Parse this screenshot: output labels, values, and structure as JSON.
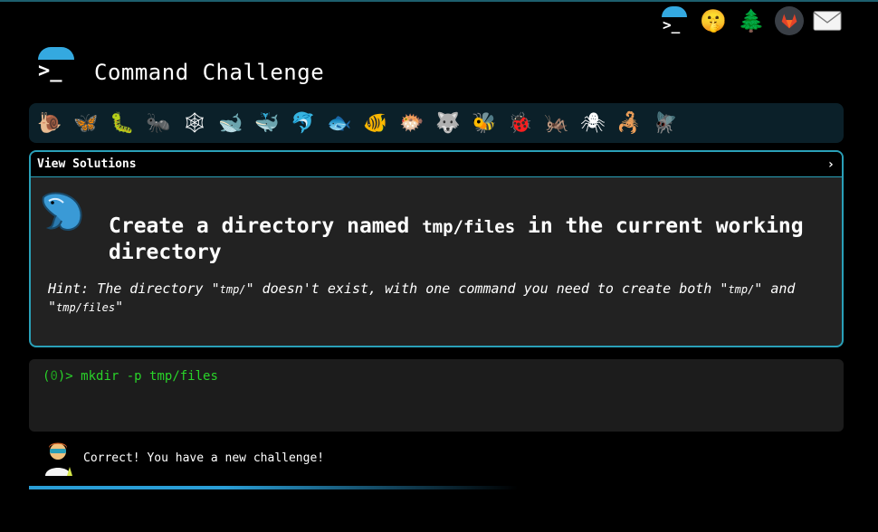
{
  "header": {
    "title": "Command Challenge"
  },
  "top_icons": [
    "terminal-icon",
    "shushing-face-icon",
    "tree-icon",
    "gitlab-icon",
    "mail-icon"
  ],
  "challenge_strip": [
    {
      "name": "snail-icon",
      "glyph": "🐌"
    },
    {
      "name": "butterfly-icon",
      "glyph": "🦋"
    },
    {
      "name": "caterpillar-icon",
      "glyph": "🐛"
    },
    {
      "name": "ant-icon",
      "glyph": "🐜"
    },
    {
      "name": "spider-web-icon",
      "glyph": "🕸"
    },
    {
      "name": "whale-icon",
      "glyph": "🐋"
    },
    {
      "name": "whale-active-icon",
      "glyph": "🐳"
    },
    {
      "name": "dolphin-icon",
      "glyph": "🐬"
    },
    {
      "name": "fish-icon",
      "glyph": "🐟"
    },
    {
      "name": "tropical-fish-icon",
      "glyph": "🐠"
    },
    {
      "name": "blowfish-icon",
      "glyph": "🐡"
    },
    {
      "name": "wolf-icon",
      "glyph": "🐺"
    },
    {
      "name": "bee-icon",
      "glyph": "🐝"
    },
    {
      "name": "ladybug-icon",
      "glyph": "🐞"
    },
    {
      "name": "cricket-icon",
      "glyph": "🦗"
    },
    {
      "name": "spider-icon",
      "glyph": "🕷"
    },
    {
      "name": "scorpion-icon",
      "glyph": "🦂"
    },
    {
      "name": "fly-icon",
      "glyph": "🪰"
    }
  ],
  "card": {
    "header_label": "View Solutions",
    "chevron": "›",
    "title_pre": "Create a directory named ",
    "title_code": "tmp/files",
    "title_post": " in the current working directory",
    "hint_1": "Hint: The directory \"",
    "hint_code_1": "tmp/",
    "hint_2": "\" doesn't exist, with one command you need to create both \"",
    "hint_code_2": "tmp/",
    "hint_3": "\" and \"",
    "hint_code_3": "tmp/files",
    "hint_4": "\""
  },
  "terminal": {
    "paren_open": "(",
    "exit_code": "0",
    "paren_close": ")> ",
    "command": "mkdir -p tmp/files"
  },
  "status": {
    "message": "Correct! You have a new challenge!"
  },
  "colors": {
    "accent": "#2aa0b8",
    "prompt_green": "#29d329",
    "umbrella_blue": "#34a9e0"
  }
}
